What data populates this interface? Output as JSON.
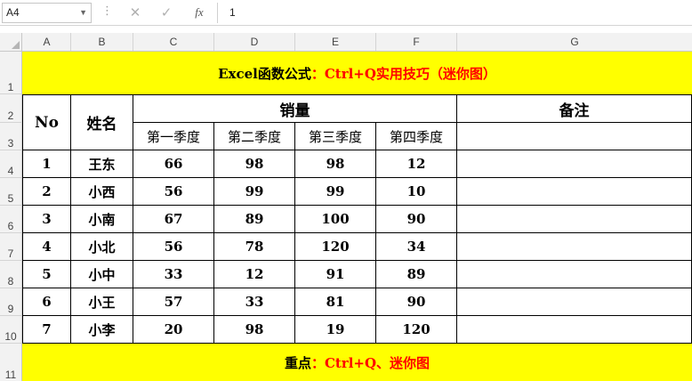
{
  "formula_bar": {
    "name_box": "A4",
    "cancel_icon": "✕",
    "enter_icon": "✓",
    "fx_label": "fx",
    "value": "1"
  },
  "columns": [
    "A",
    "B",
    "C",
    "D",
    "E",
    "F",
    "G"
  ],
  "rows": [
    "1",
    "2",
    "3",
    "4",
    "5",
    "6",
    "7",
    "8",
    "9",
    "10",
    "11"
  ],
  "title": {
    "black_part": "Excel函数公式",
    "red_part": "：Ctrl+Q实用技巧（迷你图）"
  },
  "header": {
    "no": "No",
    "name": "姓名",
    "sales": "销量",
    "remark": "备注",
    "quarters": [
      "第一季度",
      "第二季度",
      "第三季度",
      "第四季度"
    ]
  },
  "records": [
    {
      "no": "1",
      "name": "王东",
      "q": [
        "66",
        "98",
        "98",
        "12"
      ]
    },
    {
      "no": "2",
      "name": "小西",
      "q": [
        "56",
        "99",
        "99",
        "10"
      ]
    },
    {
      "no": "3",
      "name": "小南",
      "q": [
        "67",
        "89",
        "100",
        "90"
      ]
    },
    {
      "no": "4",
      "name": "小北",
      "q": [
        "56",
        "78",
        "120",
        "34"
      ]
    },
    {
      "no": "5",
      "name": "小中",
      "q": [
        "33",
        "12",
        "91",
        "89"
      ]
    },
    {
      "no": "6",
      "name": "小王",
      "q": [
        "57",
        "33",
        "81",
        "90"
      ]
    },
    {
      "no": "7",
      "name": "小李",
      "q": [
        "20",
        "98",
        "19",
        "120"
      ]
    }
  ],
  "footer": {
    "black_part": "重点",
    "red_part": "：Ctrl+Q、迷你图"
  },
  "colors": {
    "highlight": "#ffff00",
    "accent_red": "#ff0000"
  }
}
